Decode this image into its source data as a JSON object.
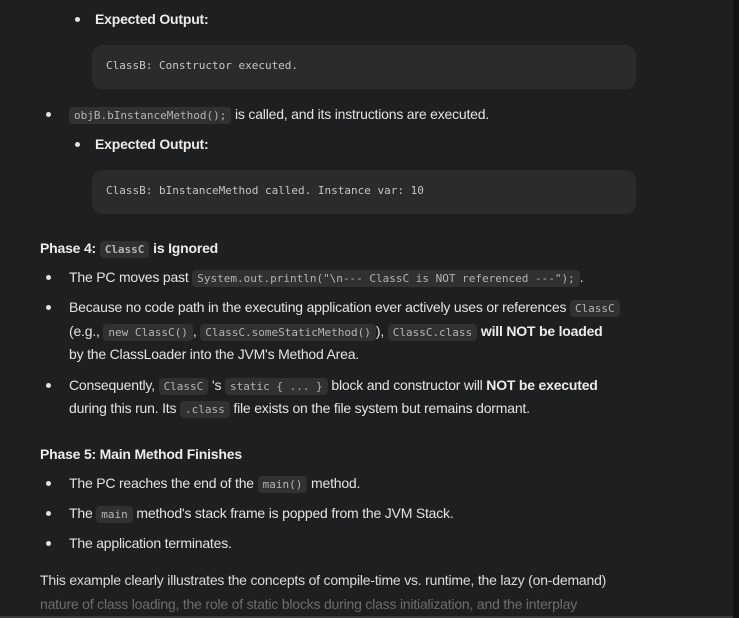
{
  "section_phase3": {
    "expected_output_1": "Expected Output:",
    "code_output_1": "ClassB: Constructor executed.",
    "bullet_call_code": "objB.bInstanceMethod();",
    "bullet_call_text": " is called, and its instructions are executed.",
    "expected_output_2": "Expected Output:",
    "code_output_2": "ClassB: bInstanceMethod called. Instance var: 10"
  },
  "phase4": {
    "title_prefix": "Phase 4: ",
    "title_code": "ClassC",
    "title_suffix": " is Ignored",
    "b1_text": "The PC moves past ",
    "b1_code": "System.out.println(\"\\n--- ClassC is NOT referenced ---\");",
    "b1_end": ".",
    "b2_line1_text": "Because no code path in the executing application ever actively uses or references ",
    "b2_line1_code": "ClassC",
    "b2_line2_open": "(e.g., ",
    "b2_line2_code1": "new ClassC()",
    "b2_line2_comma": ", ",
    "b2_line2_code2": "ClassC.someStaticMethod()",
    "b2_line2_close": "), ",
    "b2_line2_code3": "ClassC.class",
    "b2_line2_bold": " will NOT be loaded",
    "b2_line3": "by the ClassLoader into the JVM's Method Area.",
    "b3_line1_text": "Consequently, ",
    "b3_line1_code1": "ClassC",
    "b3_line1_apos": " 's ",
    "b3_line1_code2": "static { ... }",
    "b3_line1_mid": " block and constructor will ",
    "b3_line1_bold": "NOT be executed",
    "b3_line2_text": "during this run. Its ",
    "b3_line2_code": ".class",
    "b3_line2_end": " file exists on the file system but remains dormant."
  },
  "phase5": {
    "title": "Phase 5: Main Method Finishes",
    "b1_text": "The PC reaches the end of the ",
    "b1_code": "main()",
    "b1_end": " method.",
    "b2_text": "The ",
    "b2_code": "main",
    "b2_end": " method's stack frame is popped from the JVM Stack.",
    "b3_text": "The application terminates."
  },
  "summary": {
    "line1": "This example clearly illustrates the concepts of compile-time vs. runtime, the lazy (on-demand)",
    "line2": "nature of class loading, the role of static blocks during class initialization, and the interplay"
  }
}
